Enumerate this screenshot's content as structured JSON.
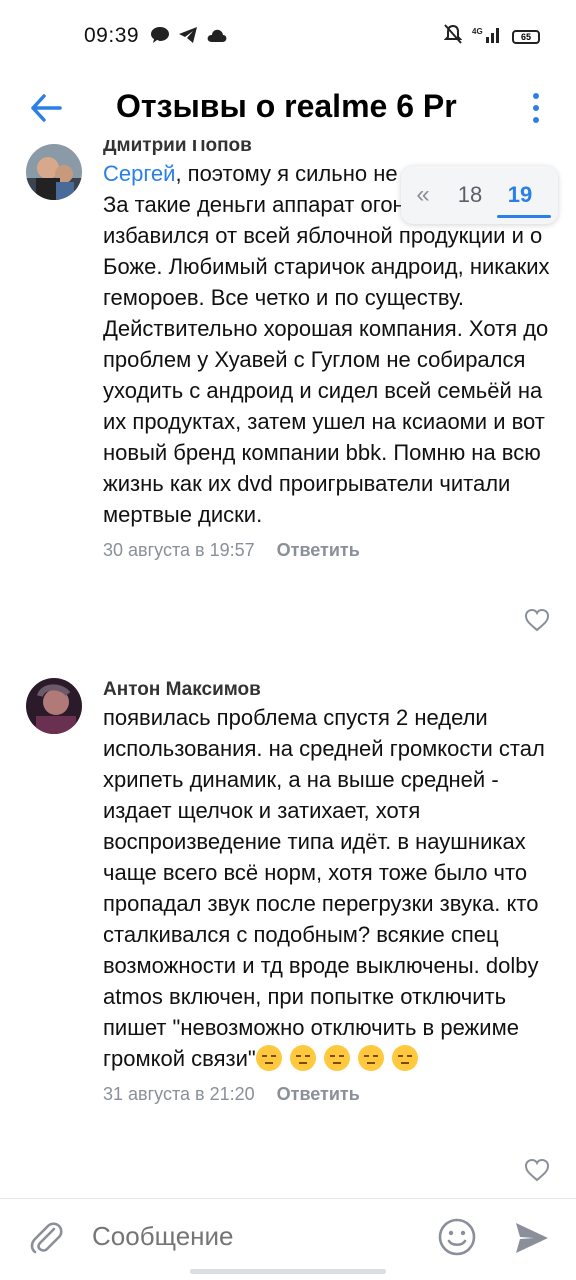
{
  "status_bar": {
    "time": "09:39",
    "battery": "65",
    "network": "4G"
  },
  "header": {
    "title": "Отзывы о realme 6 Pr"
  },
  "pager": {
    "prev_symbol": "«",
    "pages": [
      "18",
      "19"
    ],
    "active_page": "19"
  },
  "comments": [
    {
      "author": "Дмитрий Попов",
      "mention": "Сергей",
      "text": ", поэтому я сильно не напрягаюсь. За такие деньги аппарат огонь и главное я избавился от всей яблочной продукции и о Боже. Любимый старичок андроид, никаких гемороев. Все четко и по существу. Действительно хорошая компания. Хотя до проблем у Хуавей с Гуглом не собирался уходить с андроид и сидел всей семьёй на их продуктах, затем ушел на ксиаоми и вот новый бренд компании bbk. Помню на всю жизнь как их dvd проигрыватели читали мертвые диски.",
      "date": "30 августа в 19:57",
      "reply_label": "Ответить"
    },
    {
      "author": "Антон Максимов",
      "mention": "",
      "text": "появилась проблема спустя 2 недели использования. на средней громкости стал хрипеть динамик, а на выше средней - издает щелчок и затихает, хотя воспроизведение типа идёт. в наушниках чаще всего всё норм, хотя тоже было что пропадал звук после перегрузки звука. кто сталкивался с подобным? всякие спец возможности и тд вроде выключены. dolby atmos включен, при попытке отключить пишет \"невозможно отключить в режиме громкой связи\"",
      "date": "31 августа в 21:20",
      "reply_label": "Ответить"
    }
  ],
  "composer": {
    "placeholder": "Сообщение"
  },
  "colors": {
    "accent": "#2a80e6",
    "meta": "#8a8f99"
  }
}
